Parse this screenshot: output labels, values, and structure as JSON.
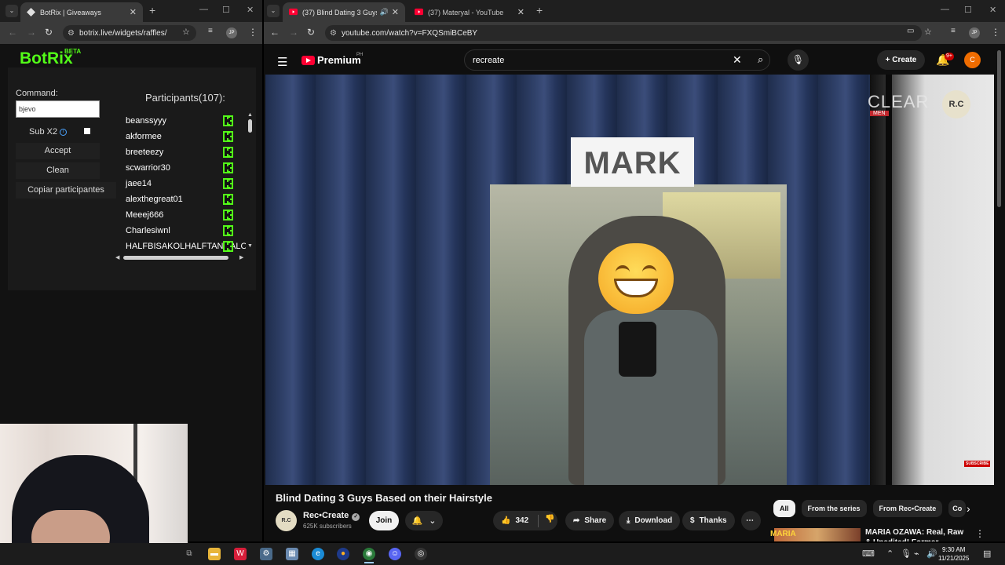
{
  "left_browser": {
    "tab_title": "BotRix | Giveaways",
    "url": "botrix.live/widgets/raffles/",
    "profile": "JP"
  },
  "right_browser": {
    "tabs": [
      {
        "title": "(37) Blind Dating 3 Guys Ba"
      },
      {
        "title": "(37) Materyal - YouTube"
      }
    ],
    "url": "youtube.com/watch?v=FXQSmiBCeBY",
    "profile": "JP"
  },
  "botrix": {
    "brand": "BotRix",
    "beta": "BETA",
    "command_label": "Command:",
    "command_value": "bjevo",
    "subx2_label": "Sub X2",
    "accept_label": "Accept",
    "clean_label": "Clean",
    "copy_label": "Copiar participantes",
    "participants_title": "Participants(107):",
    "participants": [
      {
        "name": "beanssyyy"
      },
      {
        "name": "akformee"
      },
      {
        "name": "breeteezy"
      },
      {
        "name": "scwarrior30"
      },
      {
        "name": "jaee14"
      },
      {
        "name": "alexthegreat01"
      },
      {
        "name": "Meeej666"
      },
      {
        "name": "Charlesiwnl"
      },
      {
        "name": "HALFBISAKOLHALFTANGALOG"
      }
    ],
    "kick_color": "#53fc18"
  },
  "youtube": {
    "logo_text": "Premium",
    "region": "PH",
    "search_value": "recreate",
    "create_label": "Create",
    "notif_badge": "9+",
    "user_initial": "C",
    "video": {
      "sign_text": "MARK",
      "clear_text": "CLEAR",
      "clear_sub": "MEN",
      "watermark": "R.C",
      "subscribe_text": "SUBSCRIBE"
    },
    "video_title": "Blind Dating 3 Guys Based on their Hairstyle",
    "channel_initials": "R.C",
    "channel_name": "Rec•Create",
    "subscribers": "625K subscribers",
    "join_label": "Join",
    "likes": "342",
    "share_label": "Share",
    "download_label": "Download",
    "thanks_label": "Thanks",
    "chips": [
      "All",
      "From the series",
      "From Rec•Create",
      "Co"
    ],
    "rec_thumb_text": "MARIA",
    "rec_title": "MARIA OZAWA: Real, Raw & Unedited! Former Japanese"
  },
  "taskbar": {
    "time": "9:30 AM",
    "date": "11/21/2025"
  },
  "icons": [
    "menu-icon",
    "search-icon",
    "mic-icon",
    "bell-icon",
    "like-icon",
    "dislike-icon",
    "share-icon",
    "download-icon",
    "thanks-icon",
    "more-icon",
    "kick-icon"
  ]
}
